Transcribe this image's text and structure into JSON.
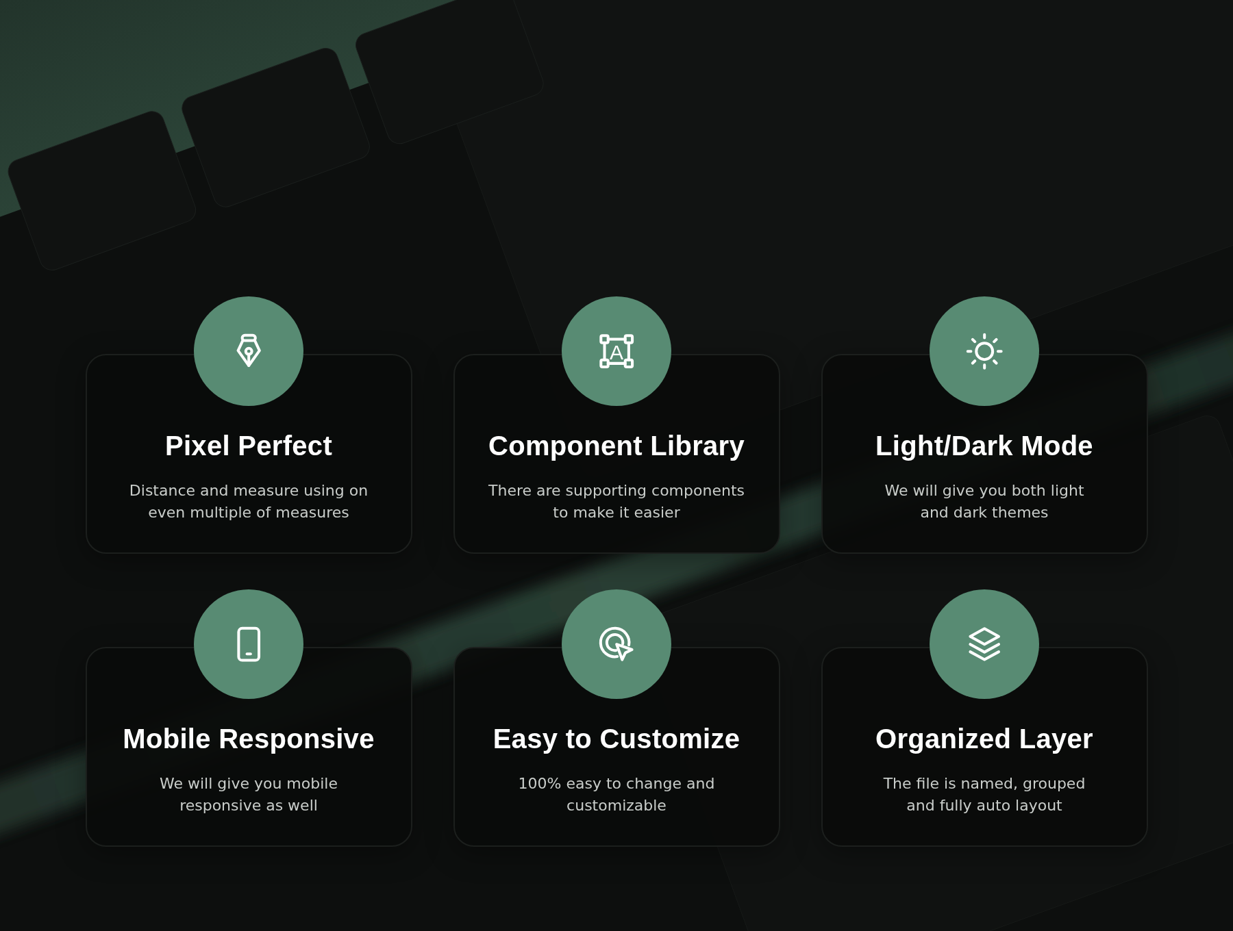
{
  "features": [
    {
      "title": "Pixel Perfect",
      "description": "Distance and measure using on\neven multiple of measures"
    },
    {
      "title": "Component Library",
      "icon_label": "A",
      "description": "There are supporting components\nto make it easier"
    },
    {
      "title": "Light/Dark Mode",
      "description": "We will give you both light\nand dark themes"
    },
    {
      "title": "Mobile Responsive",
      "description": "We will give you mobile\nresponsive as well"
    },
    {
      "title": "Easy to Customize",
      "description": "100% easy to change and\ncustomizable"
    },
    {
      "title": "Organized Layer",
      "description": "The file is named, grouped\nand fully auto layout"
    }
  ]
}
